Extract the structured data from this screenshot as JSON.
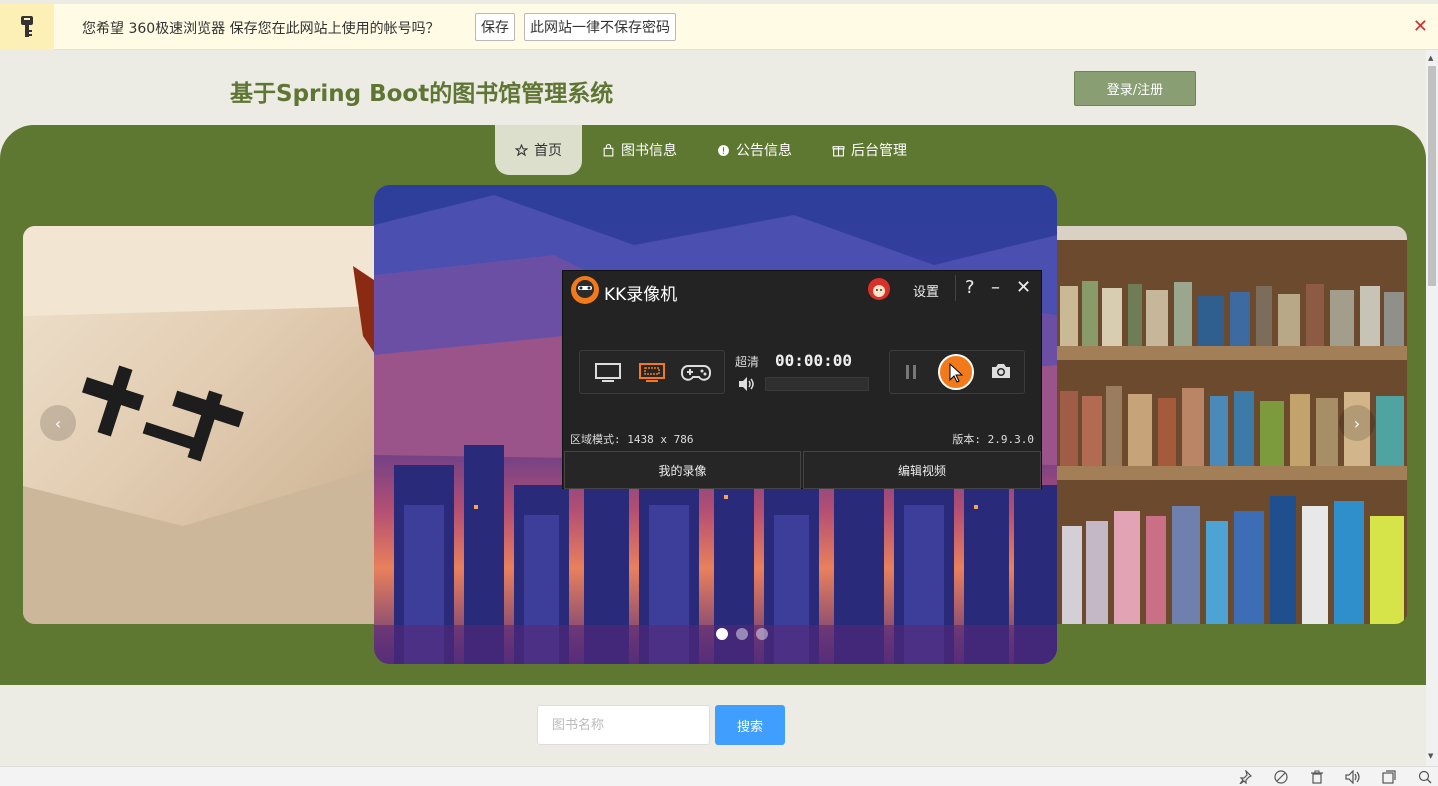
{
  "password_bar": {
    "message": "您希望 360极速浏览器 保存您在此网站上使用的帐号吗？",
    "save_label": "保存",
    "never_label": "此网站一律不保存密码",
    "close_glyph": "✕"
  },
  "header": {
    "title": "基于Spring Boot的图书馆管理系统",
    "login_label": "登录/注册"
  },
  "nav": {
    "items": [
      {
        "label": "首页",
        "icon": "star-icon",
        "active": true
      },
      {
        "label": "图书信息",
        "icon": "bag-icon",
        "active": false
      },
      {
        "label": "公告信息",
        "icon": "alert-icon",
        "active": false
      },
      {
        "label": "后台管理",
        "icon": "gift-icon",
        "active": false
      }
    ]
  },
  "carousel": {
    "prev_glyph": "‹",
    "next_glyph": "›",
    "active_index": 0,
    "dot_count": 3
  },
  "recorder": {
    "title": "KK录像机",
    "settings_label": "设置",
    "help_glyph": "?",
    "minimize_glyph": "–",
    "close_glyph": "✕",
    "quality_label": "超清",
    "time": "00:00:00",
    "region_info": "区域模式: 1438 x 786",
    "version_info": "版本: 2.9.3.0",
    "my_recordings_label": "我的录像",
    "edit_video_label": "编辑视频",
    "accent_color": "#f27a1a"
  },
  "search": {
    "placeholder": "图书名称",
    "button_label": "搜索"
  },
  "colors": {
    "banner": "#5e7731",
    "title": "#5f7533",
    "search_button": "#409eff"
  }
}
